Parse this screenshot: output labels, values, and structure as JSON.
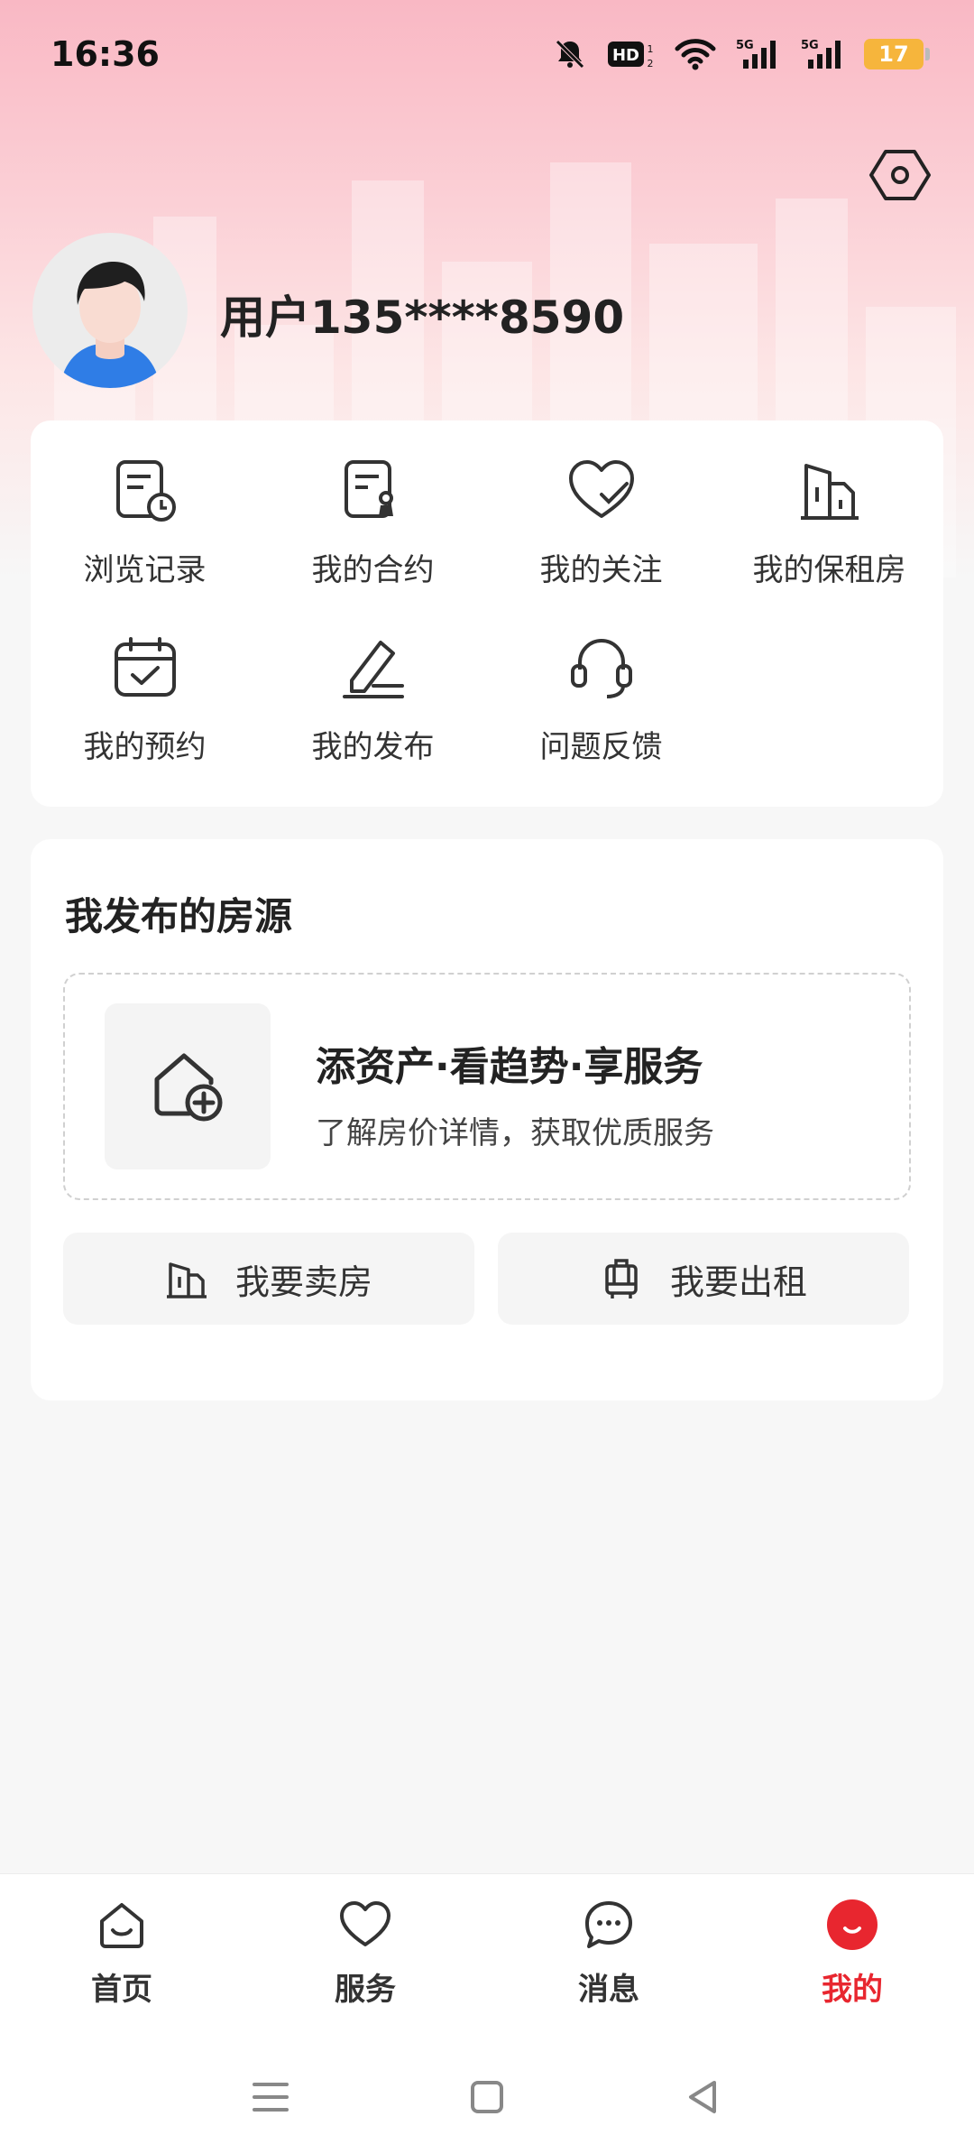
{
  "status_bar": {
    "time": "16:36",
    "battery": "17",
    "icons": [
      "mute-bell-icon",
      "hd-icon",
      "wifi-icon",
      "5g-signal-icon",
      "5g-signal-icon",
      "battery-icon"
    ]
  },
  "profile": {
    "username": "用户135****8590",
    "settings_icon": "hexagon-gear-icon"
  },
  "menu": {
    "items": [
      {
        "label": "浏览记录",
        "icon": "history-doc-icon"
      },
      {
        "label": "我的合约",
        "icon": "contract-icon"
      },
      {
        "label": "我的关注",
        "icon": "heart-check-icon"
      },
      {
        "label": "我的保租房",
        "icon": "building-icon"
      },
      {
        "label": "我的预约",
        "icon": "calendar-check-icon"
      },
      {
        "label": "我的发布",
        "icon": "edit-pen-icon"
      },
      {
        "label": "问题反馈",
        "icon": "headset-icon"
      }
    ]
  },
  "published": {
    "title": "我发布的房源",
    "promo_title": "添资产·看趋势·享服务",
    "promo_subtitle": "了解房价详情，获取优质服务",
    "sell_label": "我要卖房",
    "rent_label": "我要出租"
  },
  "tabbar": {
    "items": [
      {
        "label": "首页",
        "icon": "home-icon"
      },
      {
        "label": "服务",
        "icon": "heart-icon"
      },
      {
        "label": "消息",
        "icon": "chat-bubble-icon"
      },
      {
        "label": "我的",
        "icon": "smile-dot-icon",
        "active": true
      }
    ],
    "active_color": "#e8262f"
  },
  "colors": {
    "accent": "#e8262f",
    "hero_top": "#f9b8c4"
  }
}
